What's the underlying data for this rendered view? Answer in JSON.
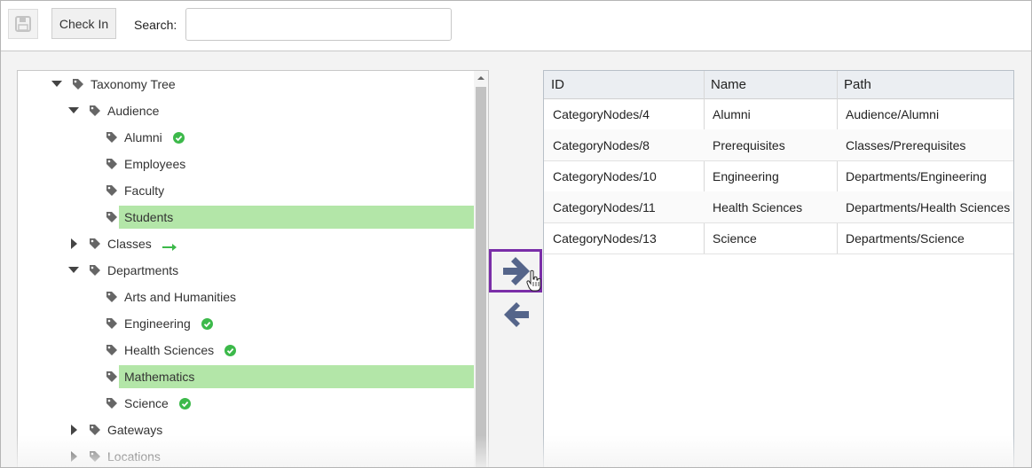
{
  "toolbar": {
    "save_icon": "save-icon",
    "checkin_label": "Check In",
    "search_label": "Search:",
    "search_value": "",
    "search_placeholder": ""
  },
  "tree": {
    "nodes": [
      {
        "label": "Taxonomy Tree",
        "level": 0,
        "expanded": true
      },
      {
        "label": "Audience",
        "level": 1,
        "expanded": true
      },
      {
        "label": "Alumni",
        "level": 2,
        "status": "check"
      },
      {
        "label": "Employees",
        "level": 2
      },
      {
        "label": "Faculty",
        "level": 2
      },
      {
        "label": "Students",
        "level": 2,
        "selected": true
      },
      {
        "label": "Classes",
        "level": 1,
        "expanded": false,
        "status": "arrow"
      },
      {
        "label": "Departments",
        "level": 1,
        "expanded": true
      },
      {
        "label": "Arts and Humanities",
        "level": 2
      },
      {
        "label": "Engineering",
        "level": 2,
        "status": "check"
      },
      {
        "label": "Health Sciences",
        "level": 2,
        "status": "check"
      },
      {
        "label": "Mathematics",
        "level": 2,
        "selected": true
      },
      {
        "label": "Science",
        "level": 2,
        "status": "check"
      },
      {
        "label": "Gateways",
        "level": 1,
        "expanded": false
      },
      {
        "label": "Locations",
        "level": 1,
        "expanded": false
      }
    ]
  },
  "grid": {
    "columns": [
      "ID",
      "Name",
      "Path"
    ],
    "rows": [
      [
        "CategoryNodes/4",
        "Alumni",
        "Audience/Alumni"
      ],
      [
        "CategoryNodes/8",
        "Prerequisites",
        "Classes/Prerequisites"
      ],
      [
        "CategoryNodes/10",
        "Engineering",
        "Departments/Engineering"
      ],
      [
        "CategoryNodes/11",
        "Health Sciences",
        "Departments/Health Sciences"
      ],
      [
        "CategoryNodes/13",
        "Science",
        "Departments/Science"
      ]
    ]
  },
  "colors": {
    "selected": "#b3e6a8",
    "check": "#3cb94a",
    "arrow_button": "#5a6b8c",
    "focus_border": "#7a2ea8"
  }
}
